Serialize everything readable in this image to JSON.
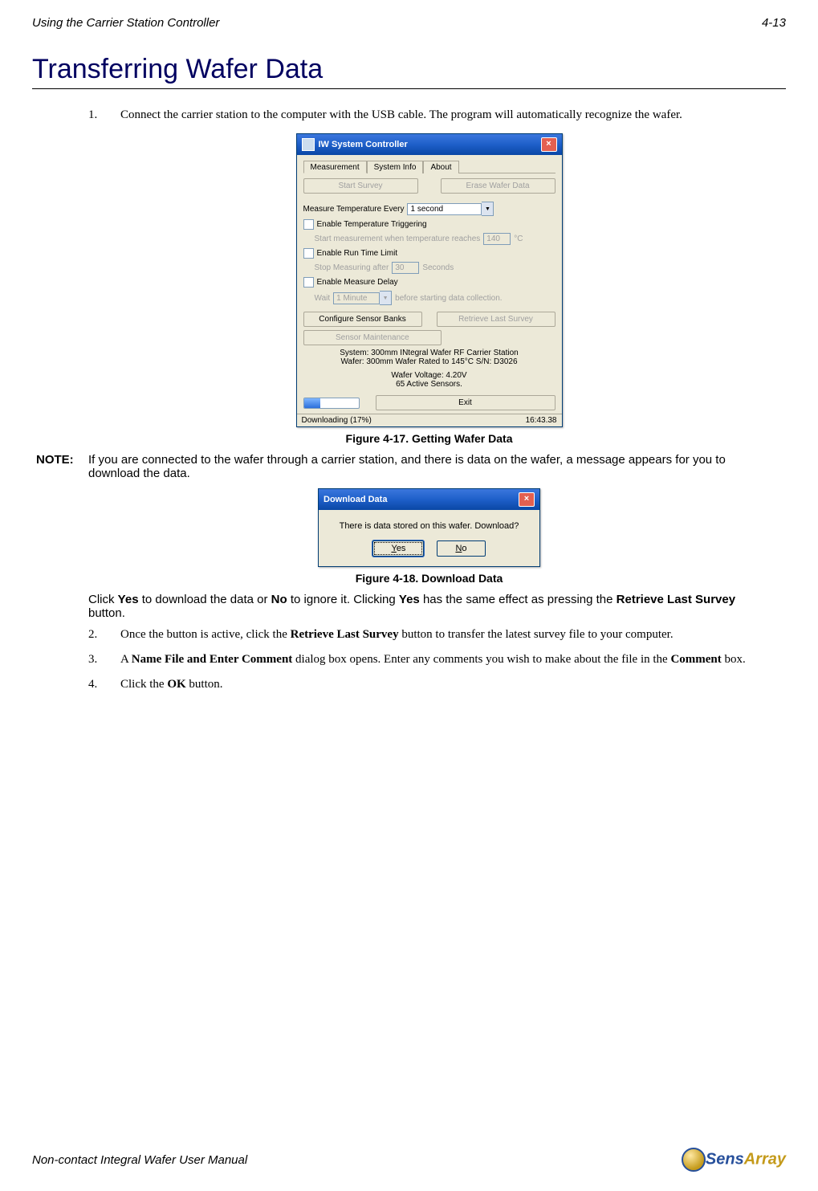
{
  "header": {
    "left": "Using the Carrier Station Controller",
    "right": "4-13"
  },
  "heading": "Transferring Wafer Data",
  "steps": {
    "s1": {
      "num": "1.",
      "text": "Connect the carrier station to the computer with the USB cable. The program will automatically recognize the wafer."
    },
    "s2": {
      "num": "2.",
      "pre": "Once the button is active, click the ",
      "bold": "Retrieve Last Survey",
      "post": " button to transfer the latest survey file to your computer."
    },
    "s3": {
      "num": "3.",
      "pre": "A ",
      "bold1": "Name File and Enter Comment",
      "mid": " dialog box opens. Enter any comments you wish to make about the file in the ",
      "bold2": "Comment",
      "post": " box."
    },
    "s4": {
      "num": "4.",
      "pre": "Click the ",
      "bold": "OK",
      "post": " button."
    }
  },
  "fig1": {
    "caption": "Figure 4-17. Getting Wafer Data",
    "title": "IW System Controller",
    "tabs": [
      "Measurement",
      "System Info",
      "About"
    ],
    "btn_start": "Start Survey",
    "btn_erase": "Erase Wafer Data",
    "label_measure_every": "Measure Temperature Every",
    "dd_interval": "1 second",
    "chk_trigger": "Enable Temperature Triggering",
    "label_trigger_sub": "Start measurement when temperature reaches",
    "trigger_val": "140",
    "trigger_unit": "°C",
    "chk_runtime": "Enable Run Time Limit",
    "label_runtime_sub": "Stop Measuring after",
    "runtime_val": "30",
    "runtime_unit": "Seconds",
    "chk_delay": "Enable Measure Delay",
    "label_delay_wait": "Wait",
    "dd_delay": "1 Minute",
    "label_delay_post": "before starting data collection.",
    "btn_configure": "Configure Sensor Banks",
    "btn_retrieve": "Retrieve Last Survey",
    "btn_maint": "Sensor Maintenance",
    "info_system": "System: 300mm INtegral Wafer RF Carrier Station",
    "info_wafer": "Wafer: 300mm Wafer Rated to 145°C S/N: D3026",
    "info_voltage": "Wafer Voltage: 4.20V",
    "info_sensors": "65 Active Sensors.",
    "btn_exit": "Exit",
    "status_left": "Downloading (17%)",
    "status_right": "16:43.38"
  },
  "note": {
    "label": "NOTE:",
    "text": "If you are connected to the wafer through a carrier station, and there is data on the wafer, a message appears for you to download the data."
  },
  "fig2": {
    "caption": "Figure 4-18. Download Data",
    "title": "Download Data",
    "msg": "There is data stored on this wafer. Download?",
    "yes_u": "Y",
    "yes_r": "es",
    "no_u": "N",
    "no_r": "o"
  },
  "note_tail": {
    "pre": "Click ",
    "b1": "Yes",
    "m1": " to download the data or ",
    "b2": "No",
    "m2": " to ignore it. Clicking ",
    "b3": "Yes",
    "m3": " has the same effect as pressing the ",
    "b4": "Retrieve Last Survey",
    "m4": " button."
  },
  "footer": {
    "text": "Non-contact Integral Wafer User Manual",
    "logo_blue": "Sens",
    "logo_gold": "Array"
  }
}
